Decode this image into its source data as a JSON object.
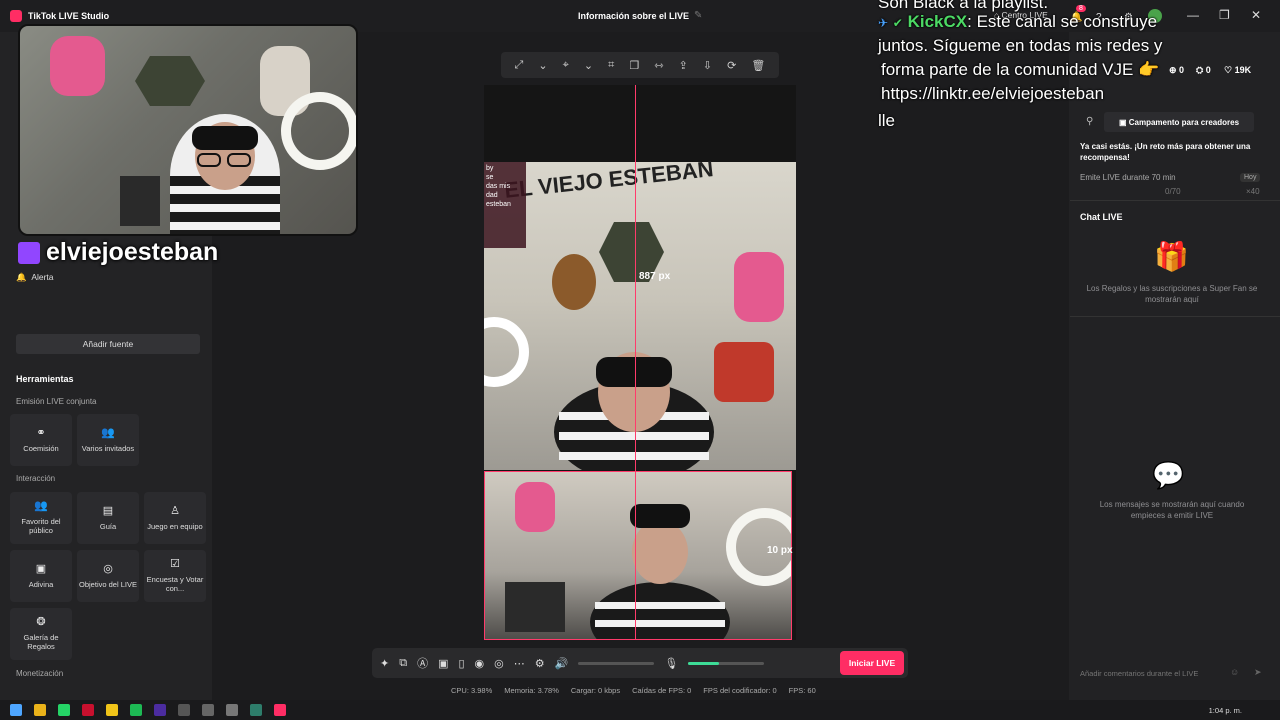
{
  "app": {
    "title": "TikTok LIVE Studio",
    "center_title": "Información sobre el LIVE"
  },
  "left": {
    "alert_label": "Alerta",
    "add_source": "Añadir fuente",
    "tools_title": "Herramientas",
    "joint_title": "Emisión LIVE conjunta",
    "interaction_title": "Interacción",
    "monetization_title": "Monetización",
    "tools": {
      "coemision": "Coemisión",
      "varios": "Varios invitados",
      "favorito": "Favorito del público",
      "guia": "Guía",
      "juego": "Juego en equipo",
      "adivina": "Adivina",
      "objetivo": "Objetivo del LIVE",
      "encuesta": "Encuesta y Votar con...",
      "galeria": "Galería de Regalos"
    }
  },
  "webcam": {
    "handle": "elviejoesteban"
  },
  "canvas": {
    "banner": "EL VIEJO ESTEBAN",
    "measure_top": "887 px",
    "measure_right": "10 px",
    "stream_overlay": "by\nse\ndas mis\ndad\nesteban"
  },
  "controls": {
    "go_live": "Iniciar LIVE",
    "mic_level": 0.4
  },
  "stats": {
    "cpu": "CPU: 3.98%",
    "mem": "Memoria: 3.78%",
    "load": "Cargar: 0 kbps",
    "fps_drop": "Caídas de FPS: 0",
    "fps_enc": "FPS del codificador: 0",
    "fps": "FPS: 60"
  },
  "right": {
    "centro": "Centro LIVE",
    "notif_count": "8",
    "stat_likes": "0",
    "stat_shares": "0",
    "stat_followers": "19K",
    "campamento": "Campamento para creadores",
    "reto_text": "Ya casi estás. ¡Un reto más para obtener una recompensa!",
    "reto_task": "Emite LIVE durante 70 min",
    "reto_day": "Hoy",
    "reto_progress": "0/70",
    "reto_reward": "×40",
    "chat_title": "Chat LIVE",
    "gifts_empty": "Los Regalos y las suscripciones a Super Fan se mostrarán aquí",
    "messages_empty": "Los mensajes se mostrarán aquí cuando empieces a emitir LIVE",
    "chat_placeholder": "Añadir comentarios durante el LIVE"
  },
  "overlay": {
    "line0": "Son Black a la playlist.",
    "user": "KickCX",
    "line1": ": Este canal se construye",
    "line2": "juntos. Sígueme en todas mis redes y",
    "line3": "forma parte de la comunidad VJE",
    "line4": "https://linktr.ee/elviejoesteban",
    "line5": "lle"
  },
  "taskbar": {
    "clock": "1:04 p. m."
  },
  "colors": {
    "accent": "#ff2d64",
    "guide": "#ff3b6b",
    "mic": "#3ddc97"
  }
}
